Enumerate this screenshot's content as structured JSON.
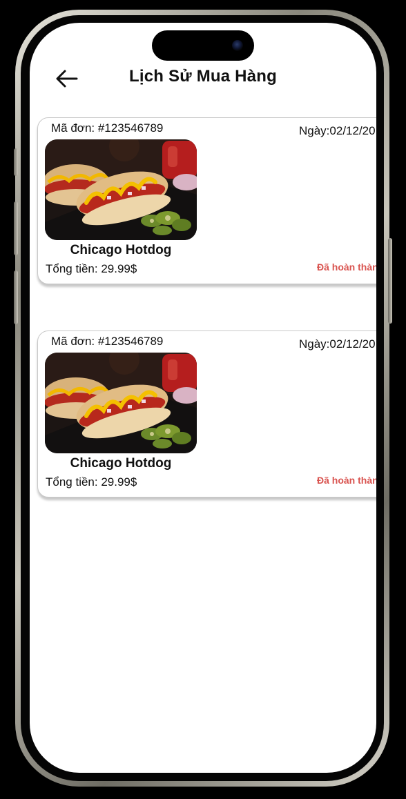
{
  "header": {
    "title": "Lịch Sử Mua Hàng",
    "back_icon": "arrow-left-icon"
  },
  "orders": [
    {
      "order_id": "Mã đơn: #123546789",
      "date": "Ngày:02/12/20",
      "food_name": "Chicago Hotdog",
      "total": "Tổng tiền: 29.99$",
      "status": "Đã hoàn thàn",
      "status_color": "#d9534f"
    },
    {
      "order_id": "Mã đơn: #123546789",
      "date": "Ngày:02/12/20",
      "food_name": "Chicago Hotdog",
      "total": "Tổng tiền: 29.99$",
      "status": "Đã hoàn thàn",
      "status_color": "#d9534f"
    }
  ]
}
